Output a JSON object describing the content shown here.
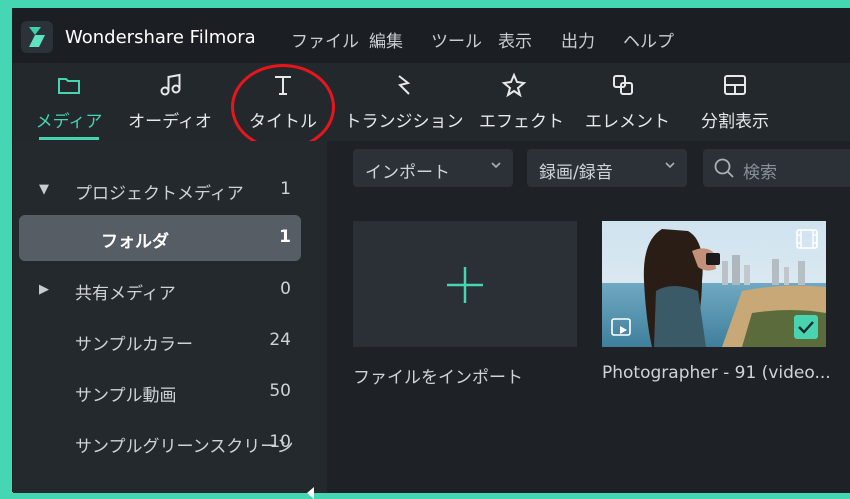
{
  "app": {
    "title": "Wondershare Filmora"
  },
  "menu": [
    "ファイル",
    "編集",
    "ツール",
    "表示",
    "出力",
    "ヘルプ"
  ],
  "toolbar": [
    {
      "label": "メディア",
      "icon": "folder-icon",
      "active": true
    },
    {
      "label": "オーディオ",
      "icon": "music-note-icon",
      "active": false
    },
    {
      "label": "タイトル",
      "icon": "text-t-icon",
      "active": false
    },
    {
      "label": "トランジション",
      "icon": "transition-icon",
      "active": false
    },
    {
      "label": "エフェクト",
      "icon": "effects-star-icon",
      "active": false
    },
    {
      "label": "エレメント",
      "icon": "elements-icon",
      "active": false
    },
    {
      "label": "分割表示",
      "icon": "split-screen-icon",
      "active": false
    }
  ],
  "library": [
    {
      "name": "プロジェクトメディア",
      "count": "1",
      "arrow": "▼"
    },
    {
      "name": "フォルダ",
      "count": "1",
      "selected": true
    },
    {
      "name": "共有メディア",
      "count": "0",
      "arrow": "▶"
    },
    {
      "name": "サンプルカラー",
      "count": "24"
    },
    {
      "name": "サンプル動画",
      "count": "50"
    },
    {
      "name": "サンプルグリーンスクリーン",
      "count": "10"
    }
  ],
  "filters": {
    "import": "インポート",
    "record": "録画/録音",
    "search_placeholder": "検索"
  },
  "media": {
    "import_label": "ファイルをインポート",
    "clip_label": "Photographer - 91 (video..."
  },
  "colors": {
    "accent": "#48d4b0",
    "annotation": "#e8161c",
    "background": "#45d6b4"
  }
}
